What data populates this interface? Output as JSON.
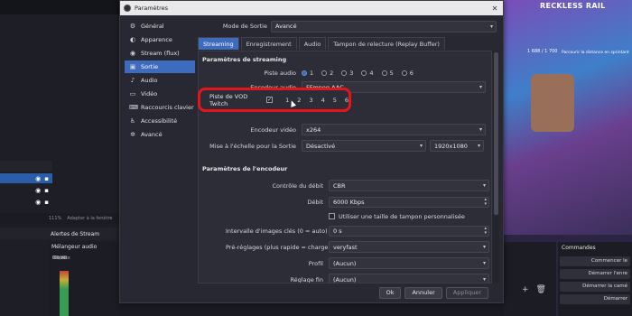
{
  "background": {
    "sources": {
      "rows": [
        "",
        "",
        ""
      ]
    },
    "zoom_text": "111%",
    "zoom_hint": "Adapter à la fenêtre",
    "alerts_label": "Alertes de Stream",
    "mixer": {
      "title": "Mélangeur audio",
      "track_label": "Global",
      "source": "Mic/Aux",
      "db": "0.0 dB"
    },
    "game": {
      "title": "RECKLESS RAIL",
      "stats": "1 688 / 1 700",
      "tip": "Parcourir la distance en sprintant"
    },
    "commands": {
      "title": "Commandes",
      "buttons": [
        "Commencer le",
        "Démarrer l'enre",
        "Démarrer la camé",
        "Démarrer"
      ]
    }
  },
  "dialog": {
    "title": "Paramètres",
    "close_glyph": "✕",
    "nav": [
      {
        "label": "Général",
        "icon": "gear-icon",
        "glyph": "⚙"
      },
      {
        "label": "Apparence",
        "icon": "palette-icon",
        "glyph": "◐"
      },
      {
        "label": "Stream (flux)",
        "icon": "globe-icon",
        "glyph": "◉"
      },
      {
        "label": "Sortie",
        "icon": "output-icon",
        "glyph": "▣"
      },
      {
        "label": "Audio",
        "icon": "speaker-icon",
        "glyph": "♪"
      },
      {
        "label": "Vidéo",
        "icon": "monitor-icon",
        "glyph": "▭"
      },
      {
        "label": "Raccourcis clavier",
        "icon": "keyboard-icon",
        "glyph": "⌨"
      },
      {
        "label": "Accessibilité",
        "icon": "accessibility-icon",
        "glyph": "♿"
      },
      {
        "label": "Avancé",
        "icon": "wrench-icon",
        "glyph": "✲"
      }
    ],
    "active_nav": "Sortie",
    "output_mode_label": "Mode de Sortie",
    "output_mode_value": "Avancé",
    "tabs": [
      "Streaming",
      "Enregistrement",
      "Audio",
      "Tampon de relecture (Replay Buffer)"
    ],
    "active_tab": "Streaming",
    "streaming_section": "Paramètres de streaming",
    "audio_track_label": "Piste audio",
    "tracks": [
      "1",
      "2",
      "3",
      "4",
      "5",
      "6"
    ],
    "audio_encoder_label": "Encodeur audio",
    "audio_encoder_value": "FFmpeg AAC",
    "vod_label": "Piste de VOD Twitch",
    "video_encoder_label": "Encodeur vidéo",
    "video_encoder_value": "x264",
    "rescale_label": "Mise à l'échelle pour la Sortie",
    "rescale_value": "Désactivé",
    "rescale_res": "1920x1080",
    "encoder_section": "Paramètres de l'encodeur",
    "rate_control_label": "Contrôle du débit",
    "rate_control_value": "CBR",
    "bitrate_label": "Débit",
    "bitrate_value": "6000 Kbps",
    "custom_buffer_label": "Utiliser une taille de tampon personnalisée",
    "keyframe_label": "Intervalle d'images clés (0 = auto)",
    "keyframe_value": "0 s",
    "preset_label": "Pré-réglages (plus rapide = charge CPU plus faible)",
    "preset_value": "veryfast",
    "profile_label": "Profil",
    "profile_value": "(Aucun)",
    "tune_label": "Réglage fin",
    "tune_value": "(Aucun)",
    "buttons": {
      "ok": "Ok",
      "cancel": "Annuler",
      "apply": "Appliquer"
    },
    "accent_color": "#3d6bbd",
    "highlight_color": "#e8141c"
  }
}
